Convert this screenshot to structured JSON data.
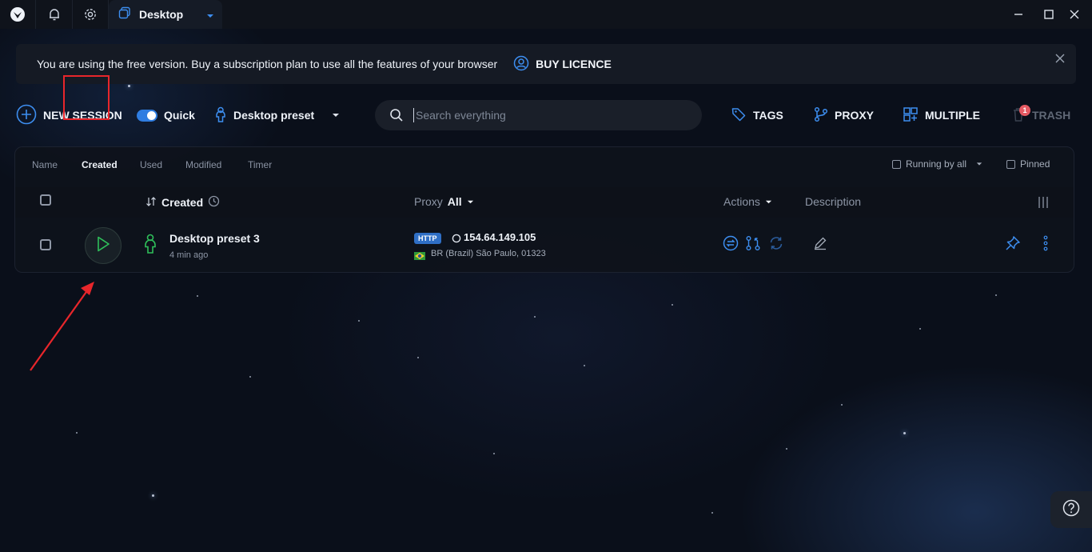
{
  "titlebar": {
    "tab_label": "Desktop"
  },
  "banner": {
    "message": "You are using the free version. Buy a subscription plan to use all the features of your browser",
    "buy_label": "BUY LICENCE"
  },
  "toolbar": {
    "new_session": "NEW SESSION",
    "quick_label": "Quick",
    "quick_on": true,
    "preset_label": "Desktop preset",
    "search_placeholder": "Search everything",
    "tags": "TAGS",
    "proxy": "PROXY",
    "multiple": "MULTIPLE",
    "trash": "TRASH",
    "trash_count": "1"
  },
  "table": {
    "sort_tabs": [
      "Name",
      "Created",
      "Used",
      "Modified",
      "Timer"
    ],
    "active_sort": "Created",
    "running_filter": "Running by all",
    "pinned_filter": "Pinned",
    "headers": {
      "created": "Created",
      "proxy": "Proxy",
      "proxy_value": "All",
      "actions": "Actions",
      "description": "Description"
    },
    "rows": [
      {
        "name": "Desktop preset 3",
        "time": "4 min ago",
        "proxy_type": "HTTP",
        "ip": "154.64.149.105",
        "location": "BR (Brazil) São Paulo, 01323"
      }
    ]
  },
  "colors": {
    "accent": "#2f7de1",
    "status_green": "#2fbf5a",
    "highlight": "#e8262b"
  }
}
